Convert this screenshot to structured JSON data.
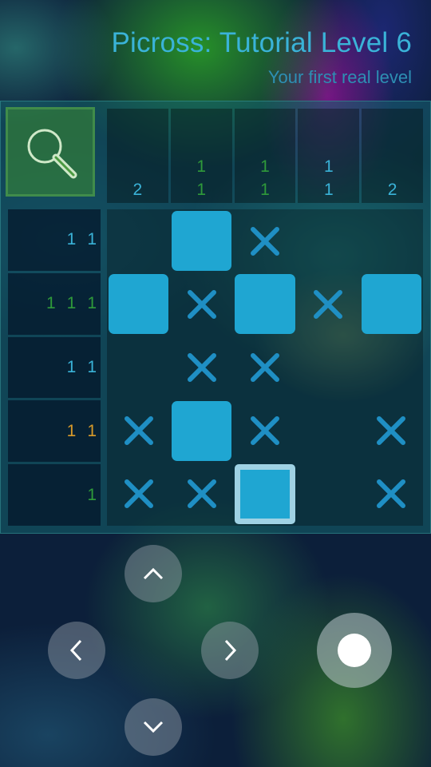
{
  "header": {
    "title": "Picross: Tutorial Level 6",
    "subtitle": "Your first real level"
  },
  "zoom_button": {
    "icon": "magnifier-icon"
  },
  "column_clues": [
    {
      "numbers": [
        "2"
      ],
      "color": "#3ab3d8"
    },
    {
      "numbers": [
        "1",
        "1"
      ],
      "color": "#2f9a3a"
    },
    {
      "numbers": [
        "1",
        "1"
      ],
      "color": "#2f9a3a"
    },
    {
      "numbers": [
        "1",
        "1"
      ],
      "color": "#3ab3d8"
    },
    {
      "numbers": [
        "2"
      ],
      "color": "#3ab3d8"
    }
  ],
  "row_clues": [
    {
      "numbers": [
        "1",
        "1"
      ],
      "color": "#3ab3d8"
    },
    {
      "numbers": [
        "1",
        "1",
        "1"
      ],
      "color": "#2f9a3a"
    },
    {
      "numbers": [
        "1",
        "1"
      ],
      "color": "#3ab3d8"
    },
    {
      "numbers": [
        "1",
        "1"
      ],
      "color": "#d89a2a"
    },
    {
      "numbers": [
        "1"
      ],
      "color": "#2f9a3a"
    }
  ],
  "grid": {
    "rows": [
      [
        "empty",
        "filled",
        "cross",
        "empty",
        "empty"
      ],
      [
        "filled",
        "cross",
        "filled",
        "cross",
        "filled"
      ],
      [
        "empty",
        "cross",
        "cross",
        "empty",
        "empty"
      ],
      [
        "cross",
        "filled",
        "cross",
        "empty",
        "cross"
      ],
      [
        "cross",
        "cross",
        "filled",
        "empty",
        "cross"
      ]
    ],
    "cursor": {
      "row": 5,
      "col": 3
    },
    "fill_color": "#1fa6d2",
    "cross_color": "#1f8fc4"
  },
  "controls": {
    "up": "chevron-up-icon",
    "down": "chevron-down-icon",
    "left": "chevron-left-icon",
    "right": "chevron-right-icon",
    "action": "fill-action-button"
  }
}
